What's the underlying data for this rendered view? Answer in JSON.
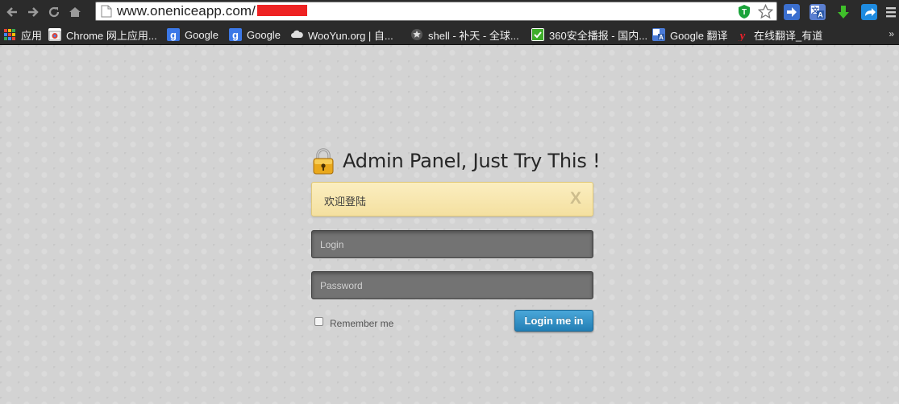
{
  "browser": {
    "url": "www.oneniceapp.com/",
    "bookmarks": [
      {
        "label": "应用",
        "icon": "apps-grid-icon"
      },
      {
        "label": "Chrome 网上应用...",
        "icon": "chrome-store-icon"
      },
      {
        "label": "Google",
        "icon": "google-icon"
      },
      {
        "label": "Google",
        "icon": "google-icon"
      },
      {
        "label": "WooYun.org | 自...",
        "icon": "cloud-icon"
      },
      {
        "label": "shell - 补天 - 全球...",
        "icon": "star-icon"
      },
      {
        "label": "360安全播报 - 国内...",
        "icon": "360-icon"
      },
      {
        "label": "Google 翻译",
        "icon": "translate-icon"
      },
      {
        "label": "在线翻译_有道",
        "icon": "youdao-icon"
      }
    ],
    "more": "»"
  },
  "panel": {
    "title": "Admin Panel, Just Try This !",
    "alert_text": "欢迎登陆",
    "alert_close": "X",
    "login_placeholder": "Login",
    "password_placeholder": "Password",
    "remember_label": "Remember me",
    "submit_label": "Login me in"
  },
  "colors": {
    "chrome_bg": "#2b2b2b",
    "page_bg": "#d3d3d3",
    "alert_bg": "#f8e8b2",
    "button_blue": "#2f8fc6"
  }
}
